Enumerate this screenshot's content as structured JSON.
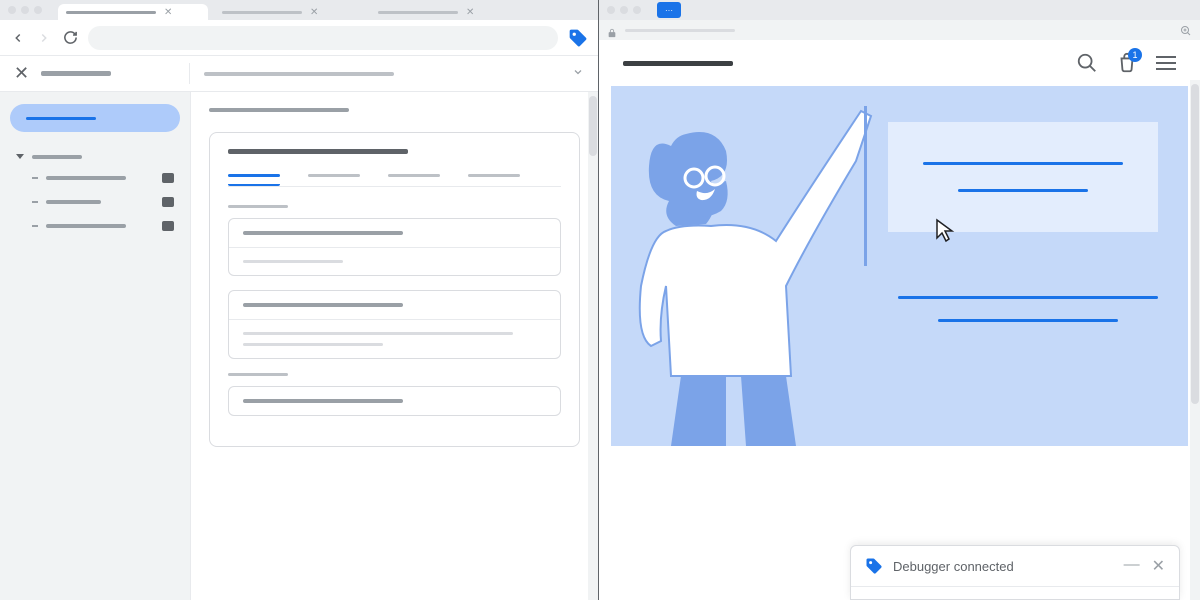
{
  "left_window": {
    "tabs": [
      {
        "active": true,
        "label_width": 90
      },
      {
        "active": false,
        "label_width": 80
      },
      {
        "active": false,
        "label_width": 80
      }
    ],
    "sidebar": {
      "active_pill": "",
      "tree_root": "",
      "children": [
        "",
        "",
        ""
      ]
    },
    "main": {
      "heading": "",
      "card": {
        "title": "",
        "tabs": [
          "",
          "",
          "",
          ""
        ],
        "active_tab": 0,
        "items": [
          {
            "title": "",
            "body_lines": 1
          },
          {
            "title": "",
            "body_lines": 2
          },
          {
            "title": "",
            "body_lines": 0
          }
        ]
      }
    }
  },
  "right_window": {
    "tag_badge": "···",
    "store": {
      "logo": "",
      "cart_count": "1",
      "promo": {
        "line1": "",
        "line2": ""
      },
      "description": [
        "",
        ""
      ]
    },
    "toast": {
      "title": "Debugger connected",
      "minimize": "—",
      "close": "✕"
    }
  },
  "colors": {
    "accent": "#1a73e8",
    "hero_bg": "#c5d9f9",
    "pill_bg": "#aecbfa"
  }
}
